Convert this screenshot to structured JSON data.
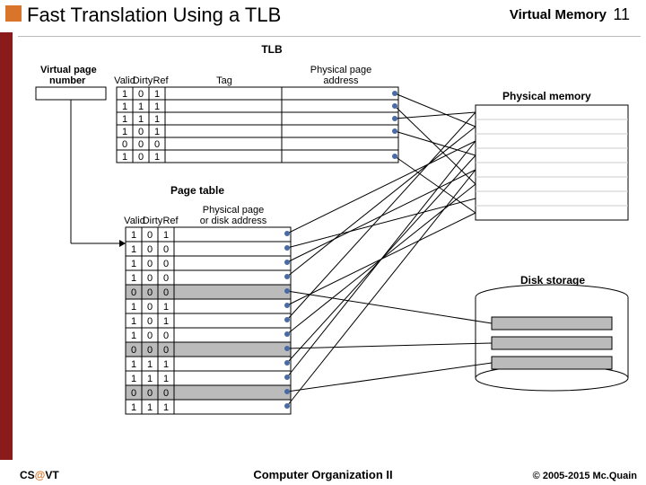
{
  "header": {
    "title": "Fast Translation Using a TLB",
    "right_label": "Virtual Memory",
    "page_number": "11"
  },
  "footer": {
    "left_pre": "CS",
    "left_at": "@",
    "left_post": "VT",
    "center": "Computer Organization II",
    "right": "© 2005-2015 Mc.Quain"
  },
  "labels": {
    "tlb": "TLB",
    "vpn_line1": "Virtual page",
    "vpn_line2": "number",
    "col_valid": "Valid",
    "col_dirty": "Dirty",
    "col_ref": "Ref",
    "col_tag": "Tag",
    "col_ppa": "Physical page",
    "col_ppa2": "address",
    "phys_mem": "Physical memory",
    "page_table": "Page table",
    "col_ppda": "Physical page",
    "col_ppda2": "or disk address",
    "disk": "Disk storage"
  },
  "tlb_rows": [
    {
      "v": "1",
      "d": "0",
      "r": "1"
    },
    {
      "v": "1",
      "d": "1",
      "r": "1"
    },
    {
      "v": "1",
      "d": "1",
      "r": "1"
    },
    {
      "v": "1",
      "d": "0",
      "r": "1"
    },
    {
      "v": "0",
      "d": "0",
      "r": "0"
    },
    {
      "v": "1",
      "d": "0",
      "r": "1"
    }
  ],
  "pt_rows": [
    {
      "v": "1",
      "d": "0",
      "r": "1",
      "shade": false
    },
    {
      "v": "1",
      "d": "0",
      "r": "0",
      "shade": false
    },
    {
      "v": "1",
      "d": "0",
      "r": "0",
      "shade": false
    },
    {
      "v": "1",
      "d": "0",
      "r": "0",
      "shade": false
    },
    {
      "v": "0",
      "d": "0",
      "r": "0",
      "shade": true
    },
    {
      "v": "1",
      "d": "0",
      "r": "1",
      "shade": false
    },
    {
      "v": "1",
      "d": "0",
      "r": "1",
      "shade": false
    },
    {
      "v": "1",
      "d": "0",
      "r": "0",
      "shade": false
    },
    {
      "v": "0",
      "d": "0",
      "r": "0",
      "shade": true
    },
    {
      "v": "1",
      "d": "1",
      "r": "1",
      "shade": false
    },
    {
      "v": "1",
      "d": "1",
      "r": "1",
      "shade": false
    },
    {
      "v": "0",
      "d": "0",
      "r": "0",
      "shade": true
    },
    {
      "v": "1",
      "d": "1",
      "r": "1",
      "shade": false
    }
  ]
}
